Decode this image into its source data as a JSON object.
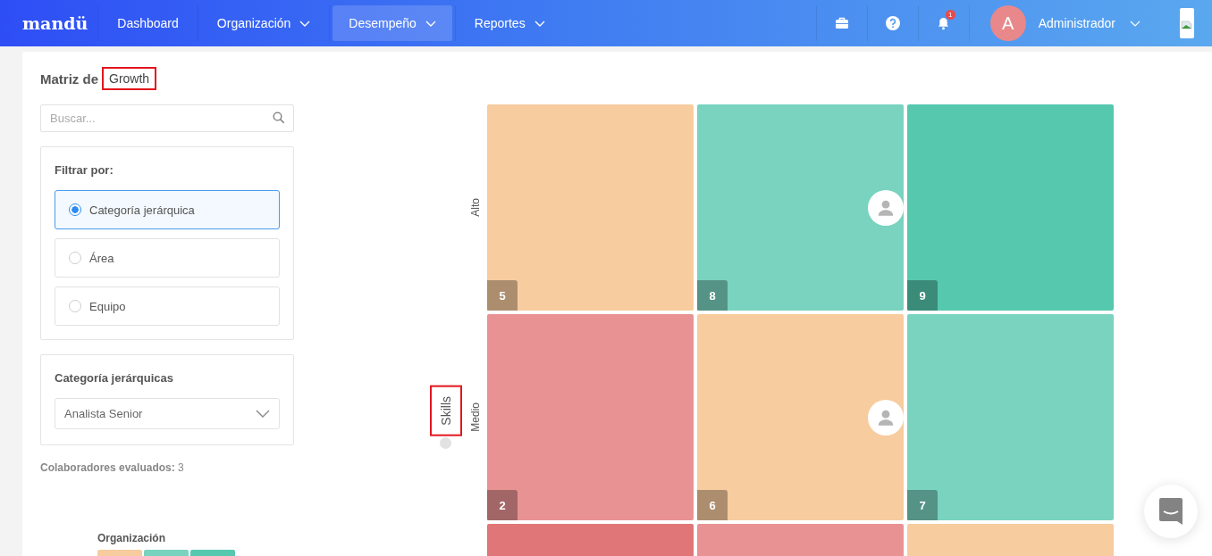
{
  "nav": {
    "logo": "mandü",
    "items": [
      {
        "label": "Dashboard",
        "dropdown": false,
        "selected": false
      },
      {
        "label": "Organización",
        "dropdown": true,
        "selected": false
      },
      {
        "label": "Desempeño",
        "dropdown": true,
        "selected": true
      },
      {
        "label": "Reportes",
        "dropdown": true,
        "selected": false
      }
    ],
    "notifications": "1",
    "user": {
      "initial": "A",
      "name": "Administrador"
    }
  },
  "sidebar": {
    "title": "Matriz de",
    "matrix_name": {
      "text": "Growth",
      "highlighted": true
    },
    "search": {
      "placeholder": "Buscar..."
    },
    "filter": {
      "title": "Filtrar por:",
      "options": [
        {
          "label": "Categoría jerárquica",
          "selected": true
        },
        {
          "label": "Área",
          "selected": false
        },
        {
          "label": "Equipo",
          "selected": false
        }
      ]
    },
    "category": {
      "title": "Categoría jerárquicas",
      "value": "Analista Senior"
    },
    "evaluated": "**Colaboradores evaluados:** 3",
    "legend": {
      "title": "Organización",
      "swatches": [
        {
          "color": "#f7cc9f"
        },
        {
          "color": "#79d3bf"
        },
        {
          "color": "#55c8ae"
        }
      ]
    }
  },
  "matrix": {
    "y_axis": {
      "text": "Skills",
      "highlighted": true
    },
    "rows": [
      {
        "label": "Alto",
        "cells": [
          {
            "number": "5",
            "color": "#f7cc9f",
            "person": false
          },
          {
            "number": "8",
            "color": "#79d3bf",
            "person": true
          },
          {
            "number": "9",
            "color": "#55c8ae",
            "person": false
          }
        ]
      },
      {
        "label": "Medio",
        "cells": [
          {
            "number": "2",
            "color": "#e89294",
            "person": false
          },
          {
            "number": "6",
            "color": "#f7cc9f",
            "person": true
          },
          {
            "number": "7",
            "color": "#79d3bf",
            "person": false
          }
        ]
      },
      {
        "cells": [
          {
            "color": "#e07677"
          },
          {
            "color": "#e89294"
          },
          {
            "color": "#f7cc9f"
          }
        ]
      }
    ]
  }
}
